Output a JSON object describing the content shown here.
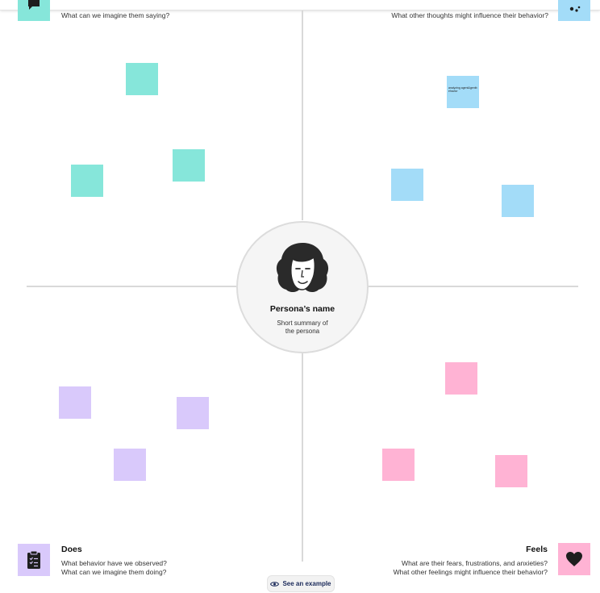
{
  "persona": {
    "name": "Persona’s name",
    "summary": "Short summary of the persona"
  },
  "quadrants": {
    "says": {
      "question": "What can we imagine them saying?"
    },
    "thinks": {
      "question": "What other thoughts might influence their behavior?"
    },
    "does": {
      "title": "Does",
      "question1": "What behavior have we observed?",
      "question2": "What can we imagine them doing?"
    },
    "feels": {
      "title": "Feels",
      "question1": "What are their fears, frustrations, and anxieties?",
      "question2": "What other feelings might influence their behavior?"
    }
  },
  "sticky_notes": {
    "thinks_note_text": "analyzing agent&gentbehavior"
  },
  "buttons": {
    "see_example": "See an example"
  },
  "colors": {
    "teal": "#86e6da",
    "blue": "#a3dcf8",
    "purple": "#d9c9fb",
    "pink": "#ffb3d4",
    "axis": "#d9d9d9"
  },
  "icons": {
    "says": "speech-icon",
    "thinks": "thought-icon",
    "does": "clipboard-icon",
    "feels": "heart-icon",
    "see_example": "eye-icon"
  }
}
